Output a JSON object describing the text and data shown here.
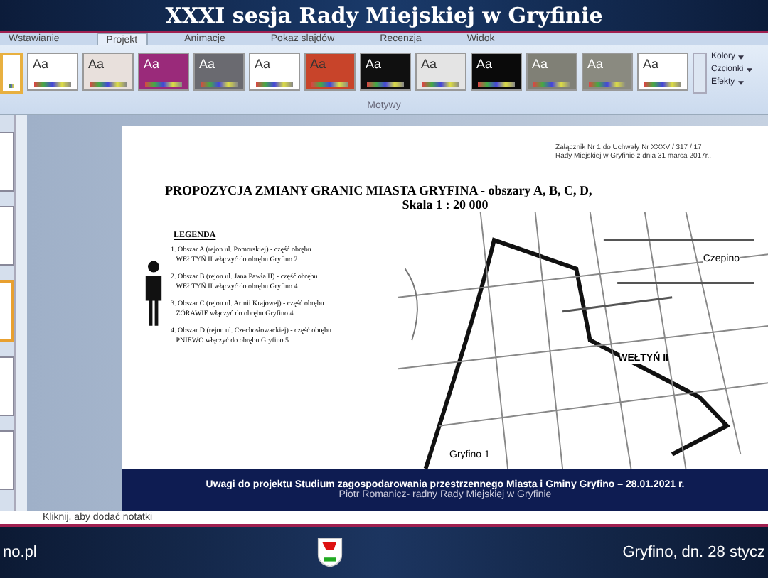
{
  "broadcast_title": "XXXI sesja Rady Miejskiej w Gryfinie",
  "ribbon_tabs": [
    {
      "label": "Wstawianie",
      "selected": false
    },
    {
      "label": "Projekt",
      "selected": true
    },
    {
      "label": "Animacje",
      "selected": false
    },
    {
      "label": "Pokaz slajdów",
      "selected": false
    },
    {
      "label": "Recenzja",
      "selected": false
    },
    {
      "label": "Widok",
      "selected": false
    }
  ],
  "themes": [
    {
      "color": "#ffffff",
      "selected": true
    },
    {
      "label": "Aa",
      "color": "#ffffff",
      "selected": false
    },
    {
      "label": "Aa",
      "color": "#e8e0dc",
      "selected": false
    },
    {
      "label": "Aa",
      "color": "#9a2a7a",
      "selected": false
    },
    {
      "label": "Aa",
      "color": "#6a6a70",
      "selected": false
    },
    {
      "label": "Aa",
      "color": "#ffffff",
      "selected": false
    },
    {
      "label": "Aa",
      "color": "#c8442a",
      "selected": false
    },
    {
      "label": "Aa",
      "color": "#101010",
      "selected": false
    },
    {
      "label": "Aa",
      "color": "#e4e4e4",
      "selected": false
    },
    {
      "label": "Aa",
      "color": "#0a0a0a",
      "selected": false
    },
    {
      "label": "Aa",
      "color": "#808076",
      "selected": false
    },
    {
      "label": "Aa",
      "color": "#8a8a80",
      "selected": false
    },
    {
      "label": "Aa",
      "color": "#ffffff",
      "selected": false
    }
  ],
  "theme_commands": [
    "Kolory",
    "Czcionki",
    "Efekty"
  ],
  "group_label": "Motywy",
  "slide_thumbnails": [
    {
      "selected": false
    },
    {
      "selected": false
    },
    {
      "selected": true
    },
    {
      "selected": false
    },
    {
      "selected": false
    }
  ],
  "slide": {
    "attachment": [
      "Załącznik Nr 1 do Uchwały Nr XXXV / 317 / 17",
      "Rady Miejskiej w Gryfinie z dnia 31 marca 2017r.,"
    ],
    "title": "PROPOZYCJA ZMIANY GRANIC MIASTA GRYFINA - obszary A, B, C, D,",
    "scale": "Skala 1 : 20 000",
    "legend_heading": "LEGENDA",
    "legend_items": [
      [
        "1. Obszar A (rejon ul. Pomorskiej) - część obrębu",
        "WEŁTYŃ II włączyć do obrębu Gryfino 2"
      ],
      [
        "2. Obszar B (rejon ul. Jana Pawła II) - część obrębu",
        "WEŁTYŃ II włączyć do obrębu Gryfino 4"
      ],
      [
        "3. Obszar C (rejon ul. Armii Krajowej) - część obrębu",
        "ŻÓRAWIE włączyć do obrębu Gryfino 4"
      ],
      [
        "4. Obszar D (rejon ul. Czechosłowackiej) - część obrębu",
        "PNIEWO włączyć do obrębu Gryfino 5"
      ]
    ],
    "map_labels": [
      "Czepino",
      "WEŁTYŃ II",
      "Gryfino 1"
    ],
    "footer": [
      "Uwagi do projektu Studium zagospodarowania przestrzennego Miasta i Gminy Gryfino – 28.01.2021 r.",
      "Piotr Romanicz- radny Rady Miejskiej w Gryfinie"
    ]
  },
  "notes_placeholder": "Kliknij, aby dodać notatki",
  "bottom_left": "no.pl",
  "bottom_right": "Gryfino, dn. 28 stycz"
}
